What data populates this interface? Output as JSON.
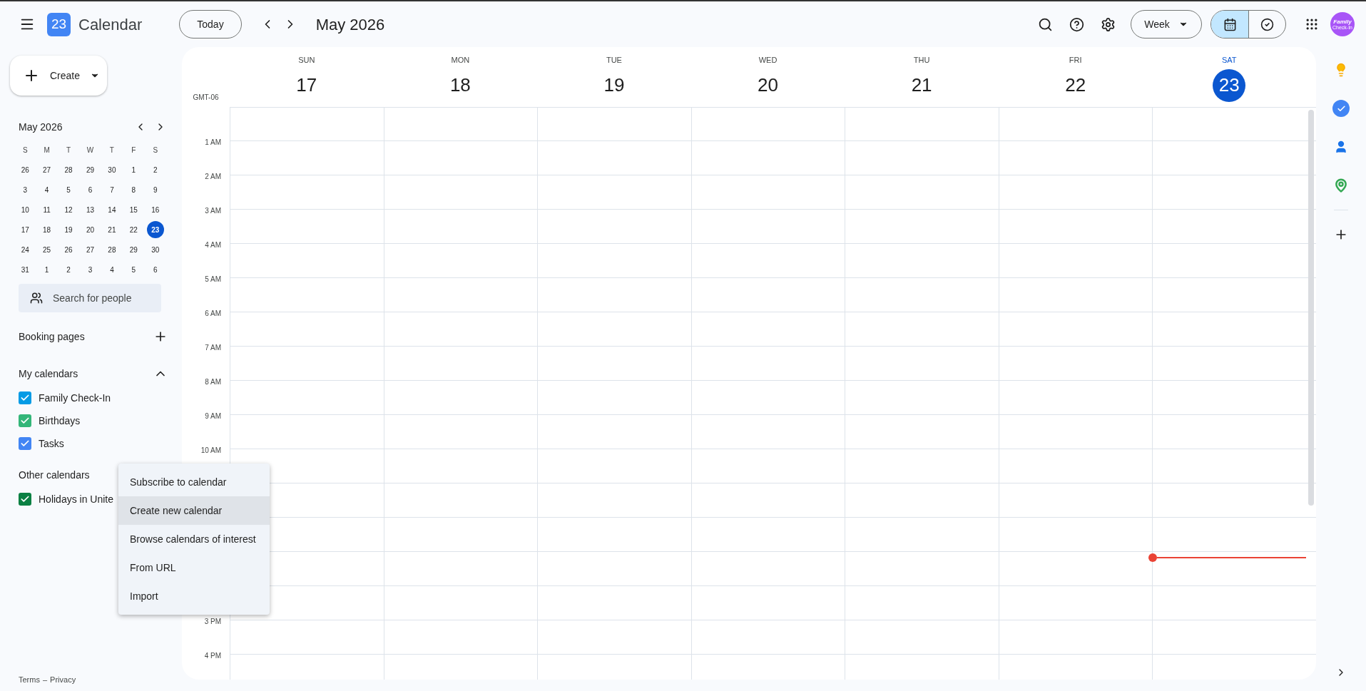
{
  "header": {
    "app_name": "Calendar",
    "logo_text": "23",
    "today_button": "Today",
    "period": "May 2026",
    "view_button": "Week",
    "view_modes": [
      {
        "kind": "calendar",
        "selected": true
      },
      {
        "kind": "tasks",
        "selected": false
      }
    ],
    "avatar": {
      "line_1": "Family",
      "line_2": "Check-In"
    }
  },
  "sidebar": {
    "create_button": "Create",
    "mini_calendar": {
      "title": "May 2026",
      "weekdays": [
        "S",
        "M",
        "T",
        "W",
        "T",
        "F",
        "S"
      ],
      "weeks": [
        [
          {
            "label": "26",
            "selected": false
          },
          {
            "label": "27",
            "selected": false
          },
          {
            "label": "28",
            "selected": false
          },
          {
            "label": "29",
            "selected": false
          },
          {
            "label": "30",
            "selected": false
          },
          {
            "label": "1",
            "selected": false
          },
          {
            "label": "2",
            "selected": false
          }
        ],
        [
          {
            "label": "3",
            "selected": false
          },
          {
            "label": "4",
            "selected": false
          },
          {
            "label": "5",
            "selected": false
          },
          {
            "label": "6",
            "selected": false
          },
          {
            "label": "7",
            "selected": false
          },
          {
            "label": "8",
            "selected": false
          },
          {
            "label": "9",
            "selected": false
          }
        ],
        [
          {
            "label": "10",
            "selected": false
          },
          {
            "label": "11",
            "selected": false
          },
          {
            "label": "12",
            "selected": false
          },
          {
            "label": "13",
            "selected": false
          },
          {
            "label": "14",
            "selected": false
          },
          {
            "label": "15",
            "selected": false
          },
          {
            "label": "16",
            "selected": false
          }
        ],
        [
          {
            "label": "17",
            "selected": false
          },
          {
            "label": "18",
            "selected": false
          },
          {
            "label": "19",
            "selected": false
          },
          {
            "label": "20",
            "selected": false
          },
          {
            "label": "21",
            "selected": false
          },
          {
            "label": "22",
            "selected": false
          },
          {
            "label": "23",
            "selected": true
          }
        ],
        [
          {
            "label": "24",
            "selected": false
          },
          {
            "label": "25",
            "selected": false
          },
          {
            "label": "26",
            "selected": false
          },
          {
            "label": "27",
            "selected": false
          },
          {
            "label": "28",
            "selected": false
          },
          {
            "label": "29",
            "selected": false
          },
          {
            "label": "30",
            "selected": false
          }
        ],
        [
          {
            "label": "31",
            "selected": false
          },
          {
            "label": "1",
            "selected": false
          },
          {
            "label": "2",
            "selected": false
          },
          {
            "label": "3",
            "selected": false
          },
          {
            "label": "4",
            "selected": false
          },
          {
            "label": "5",
            "selected": false
          },
          {
            "label": "6",
            "selected": false
          }
        ]
      ]
    },
    "search": {
      "placeholder": "Search for people"
    },
    "booking_pages": "Booking pages",
    "my_calendars": {
      "title": "My calendars",
      "expanded": true,
      "items": [
        {
          "label": "Family Check-In",
          "checked": true,
          "color": "#039be5"
        },
        {
          "label": "Birthdays",
          "checked": true,
          "color": "#33b679"
        },
        {
          "label": "Tasks",
          "checked": true,
          "color": "#4285f4"
        }
      ]
    },
    "other_calendars": {
      "title": "Other calendars",
      "items": [
        {
          "label": "Holidays in Unite",
          "checked": true,
          "color": "#0b8043"
        }
      ]
    },
    "footer": {
      "terms": "Terms",
      "separator": "–",
      "privacy": "Privacy"
    }
  },
  "week": {
    "timezone": "GMT-06",
    "days": [
      {
        "name": "SUN",
        "date": "17",
        "today": false
      },
      {
        "name": "MON",
        "date": "18",
        "today": false
      },
      {
        "name": "TUE",
        "date": "19",
        "today": false
      },
      {
        "name": "WED",
        "date": "20",
        "today": false
      },
      {
        "name": "THU",
        "date": "21",
        "today": false
      },
      {
        "name": "FRI",
        "date": "22",
        "today": false
      },
      {
        "name": "SAT",
        "date": "23",
        "today": true
      }
    ],
    "time_labels_upper": [
      "1 AM",
      "2 AM",
      "3 AM",
      "4 AM",
      "5 AM",
      "6 AM",
      "7 AM",
      "8 AM",
      "9 AM",
      "10 AM"
    ],
    "time_labels_lower": [
      "3 PM",
      "4 PM"
    ]
  },
  "menu": {
    "items": [
      {
        "label": "Subscribe to calendar",
        "selected": false
      },
      {
        "label": "Create new calendar",
        "selected": true
      },
      {
        "label": "Browse calendars of interest",
        "selected": false
      },
      {
        "label": "From URL",
        "selected": false
      },
      {
        "label": "Import",
        "selected": false
      }
    ]
  }
}
